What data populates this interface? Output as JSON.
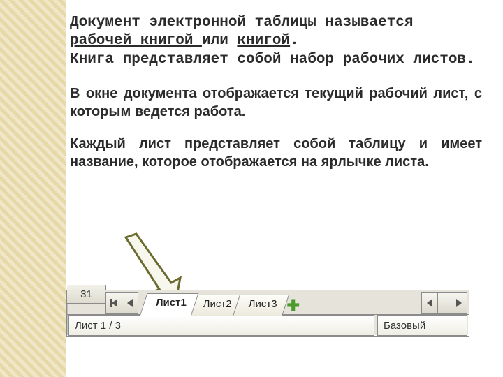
{
  "para1": {
    "t1": "Документ электронной таблицы  называется ",
    "u1": "рабочей книгой ",
    "t2": "или ",
    "u2": "книгой",
    "t3": ".",
    "line2": "Книга представляет собой набор рабочих листов."
  },
  "para2": "В окне документа отображается текущий рабочий лист, с которым ведется работа.",
  "para3": "Каждый лист представляет собой таблицу и имеет название, которое отображается на ярлычке листа.",
  "ui": {
    "row_number": "31",
    "tabs": [
      "Лист1",
      "Лист2",
      "Лист3"
    ],
    "add_symbol": "✚",
    "status_left": "Лист 1 / 3",
    "status_right": "Базовый"
  }
}
